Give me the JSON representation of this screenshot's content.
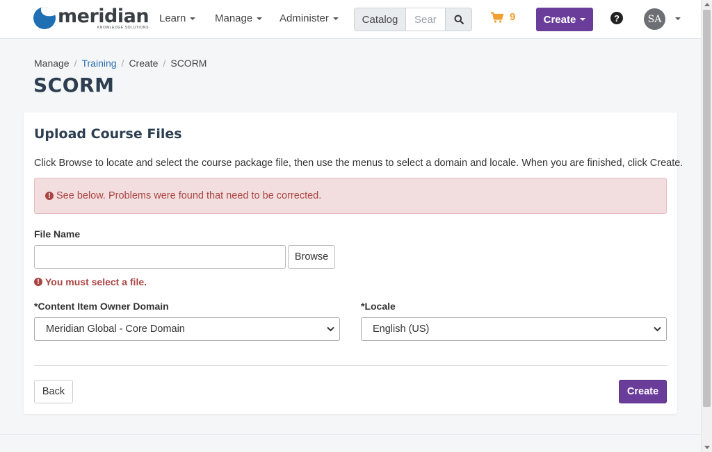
{
  "brand": {
    "name": "meridian",
    "tagline": "KNOWLEDGE SOLUTIONS",
    "color": "#1f6fb2"
  },
  "navbar": {
    "items": [
      {
        "label": "Learn"
      },
      {
        "label": "Manage"
      },
      {
        "label": "Administer"
      }
    ],
    "catalog_label": "Catalog",
    "search_placeholder": "Sear",
    "cart_count": "9",
    "create_label": "Create",
    "avatar_initials": "SA",
    "accent_color": "#6a3d9a",
    "cart_color": "#f0a030"
  },
  "breadcrumb": {
    "items": [
      "Manage",
      "Training",
      "Create",
      "SCORM"
    ]
  },
  "page": {
    "title": "SCORM"
  },
  "form": {
    "heading": "Upload Course Files",
    "instructions": "Click Browse to locate and select the course package file, then use the menus to select a domain and locale. When you are finished, click Create.",
    "alert_text": "See below. Problems were found that need to be corrected.",
    "file_name_label": "File Name",
    "file_name_value": "",
    "browse_label": "Browse",
    "file_error": "You must select a file.",
    "domain_label": "*Content Item Owner Domain",
    "domain_value": "Meridian Global - Core Domain",
    "locale_label": "*Locale",
    "locale_value": "English (US)",
    "back_label": "Back",
    "create_label": "Create",
    "error_color": "#a94442"
  }
}
